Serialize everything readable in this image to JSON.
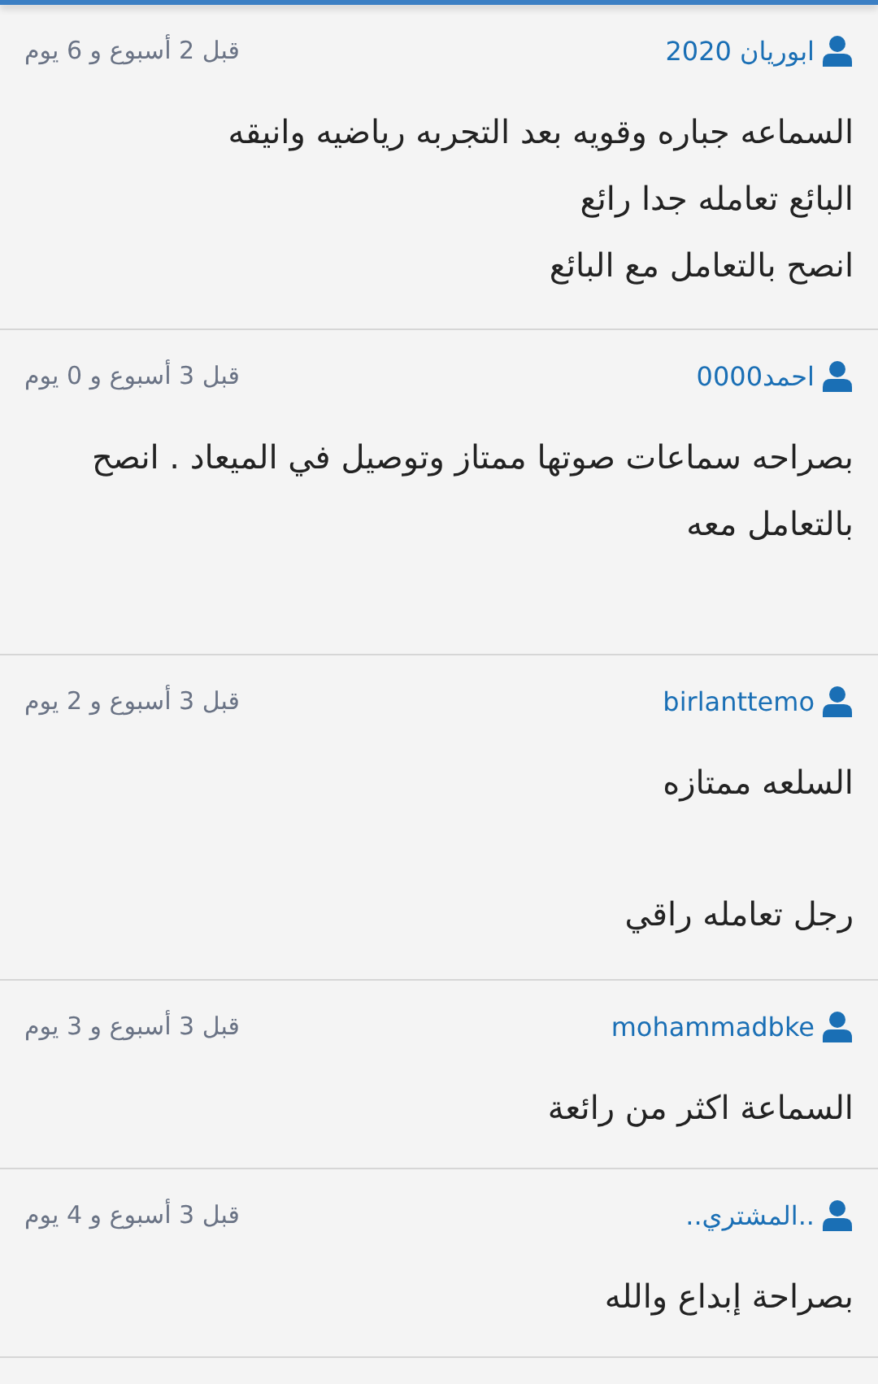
{
  "reviews": [
    {
      "user": "ابوريان 2020",
      "time": "قبل 2 أسبوع و 6 يوم",
      "paragraphs": [
        [
          "السماعه جباره وقويه بعد التجربه رياضيه وانيقه",
          "البائع تعامله جدا رائع",
          "انصح بالتعامل مع البائع"
        ]
      ]
    },
    {
      "user": "احمد0000",
      "time": "قبل 3 أسبوع و 0 يوم",
      "paragraphs": [
        [
          "بصراحه سماعات صوتها ممتاز وتوصيل في الميعاد . انصح بالتعامل معه"
        ]
      ]
    },
    {
      "user": "birlanttemo",
      "time": "قبل 3 أسبوع و 2 يوم",
      "paragraphs": [
        [
          "السلعه ممتازه"
        ],
        [
          "رجل تعامله راقي"
        ]
      ]
    },
    {
      "user": "mohammadbke",
      "time": "قبل 3 أسبوع و 3 يوم",
      "paragraphs": [
        [
          "السماعة اكثر من رائعة"
        ]
      ]
    },
    {
      "user": "..المشتري..",
      "time": "قبل 3 أسبوع و 4 يوم",
      "paragraphs": [
        [
          "بصراحة إبداع والله"
        ]
      ]
    }
  ]
}
